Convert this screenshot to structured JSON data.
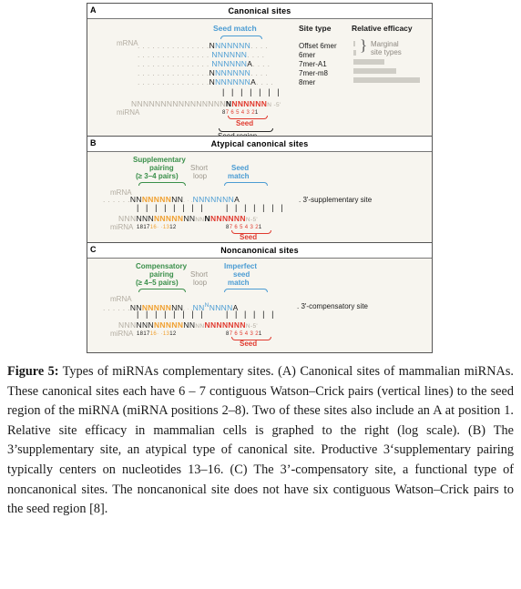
{
  "figure": {
    "panels": [
      {
        "letter": "A",
        "title": "Canonical sites",
        "headers": {
          "seed_match": "Seed match",
          "site_type": "Site type",
          "relative_efficacy": "Relative efficacy"
        },
        "mrna_label": "mRNA",
        "mirna_label": "miRNA",
        "marginal_note_line1": "Marginal",
        "marginal_note_line2": "site types",
        "dots_left": ". . . . . . . . . . . . . . .",
        "dots_right": ". . . .",
        "rows": [
          {
            "site_type": "Offset 6mer",
            "prefix_n": "N",
            "seed_n": "NNNNNN",
            "suffix_a": "",
            "efficacy": 2
          },
          {
            "site_type": "6mer",
            "prefix_n": "",
            "seed_n": "NNNNNN",
            "suffix_a": "",
            "efficacy": 3
          },
          {
            "site_type": "7mer-A1",
            "prefix_n": "",
            "seed_n": "NNNNNN",
            "suffix_a": "A",
            "efficacy": 42
          },
          {
            "site_type": "7mer-m8",
            "prefix_n": "N",
            "seed_n": "NNNNNN",
            "suffix_a": "",
            "efficacy": 58
          },
          {
            "site_type": "8mer",
            "prefix_n": "N",
            "seed_n": "NNNNNN",
            "suffix_a": "A",
            "efficacy": 90
          }
        ],
        "pair_bars": "| | | | | | |",
        "mirna_tail": "NNNNNNNNNNNNNNNN",
        "mirna_black_n": "N",
        "mirna_seed_n": "NNNNNN",
        "mirna_end": "N -5'",
        "pos_8": "8",
        "pos_numbers": "7 6 5 4 3 2",
        "pos_1": "1",
        "seed_label": "Seed",
        "seed_region_label": "Seed region"
      },
      {
        "letter": "B",
        "title": "Atypical canonical sites",
        "supp_line1": "Supplementary",
        "supp_line2": "pairing",
        "supp_line3": "(≥ 3–4 pairs)",
        "short_loop_line1": "Short",
        "short_loop_line2": "loop",
        "seed_match_line1": "Seed",
        "seed_match_line2": "match",
        "mrna_label": "mRNA",
        "mirna_label": "miRNA",
        "site_name": ". 3'-supplementary site",
        "mrna_dots": ". . . . . .",
        "mrna_pre": "NN",
        "mrna_supp": "NNNNN",
        "mrna_post": "NN",
        "loop_dots": ". · .",
        "mrna_seed": "NNNNNNN",
        "mrna_a": "A",
        "bars_left": "| | | | | | | |",
        "bars_right": "| | | | | | |",
        "mirna_grey_tail": "NNN",
        "mirna_pre": "NNN",
        "mirna_supp": "NNNNN",
        "mirna_post": "NN",
        "loop_sub": "NN",
        "mirna_black_n": "N",
        "mirna_seed": "NNNNNN",
        "mirna_end": "N-5'",
        "num_18": "18",
        "num_17": "17",
        "num_16": "16",
        "num_dots": "· ·",
        "num_13": "13",
        "num_12": "12",
        "pos_8": "8",
        "pos_numbers": "7 6 5 4 3 2",
        "pos_1": "1",
        "seed_label": "Seed"
      },
      {
        "letter": "C",
        "title": "Noncanonical sites",
        "comp_line1": "Compensatory",
        "comp_line2": "pairing",
        "comp_line3": "(≥ 4–5 pairs)",
        "short_loop_line1": "Short",
        "short_loop_line2": "loop",
        "imperfect_line1": "Imperfect",
        "imperfect_line2": "seed",
        "imperfect_line3": "match",
        "mrna_label": "mRNA",
        "mirna_label": "miRNA",
        "site_name": ". 3'-compensatory site",
        "mrna_dots": ". . . . . .",
        "mrna_pre": "NN",
        "mrna_comp": "NNNNN",
        "mrna_post": "NN",
        "loop_dots": ". · .",
        "mrna_seed_a": "NN",
        "mrna_bulge": "N",
        "mrna_seed_b": "NNNN",
        "mrna_a": "A",
        "bars_left": "| | | | | | | |",
        "bars_right_a": "| |",
        "bars_right_b": "| | | |",
        "mirna_grey_tail": "NNN",
        "mirna_pre": "NNN",
        "mirna_comp": "NNNNN",
        "mirna_post": "NN",
        "loop_sub": "NN",
        "mirna_black_n": "N",
        "mirna_seed": "NNNNNN",
        "mirna_end": "N-5'",
        "num_18": "18",
        "num_17": "17",
        "num_16": "16",
        "num_dots": "· ·",
        "num_13": "13",
        "num_12": "12",
        "pos_8": "8",
        "pos_numbers": "7 6 5 4 3 2",
        "pos_1": "1",
        "seed_label": "Seed"
      }
    ]
  },
  "caption": {
    "label": "Figure 5:",
    "text": " Types of miRNAs complementary sites. (A) Canonical sites of mammalian miRNAs. These canonical sites each have 6 – 7 contiguous Watson–Crick pairs (vertical lines) to the seed region of the miRNA (miRNA positions 2–8). Two of these sites also include an A at position 1. Relative site efficacy in mammalian cells is graphed to the right (log scale). (B) The 3’supplementary site, an atypical type of canonical site. Productive 3‘supplementary pairing typically centers on nucleotides 13–16. (C) The 3’-compensatory site, a functional type of noncanonical sites. The noncanonical site does not have six contiguous Watson–Crick pairs to the seed region [8]."
  },
  "chart_data": {
    "type": "bar",
    "title": "Relative efficacy",
    "categories": [
      "Offset 6mer",
      "6mer",
      "7mer-A1",
      "7mer-m8",
      "8mer"
    ],
    "values": [
      2,
      3,
      42,
      58,
      90
    ],
    "xlabel": "",
    "ylabel": "",
    "xlim": [
      0,
      100
    ],
    "scale": "log",
    "grid": false,
    "orientation": "horizontal",
    "bar_color": "#cfcdc6",
    "annotations": [
      "Marginal site types"
    ]
  }
}
